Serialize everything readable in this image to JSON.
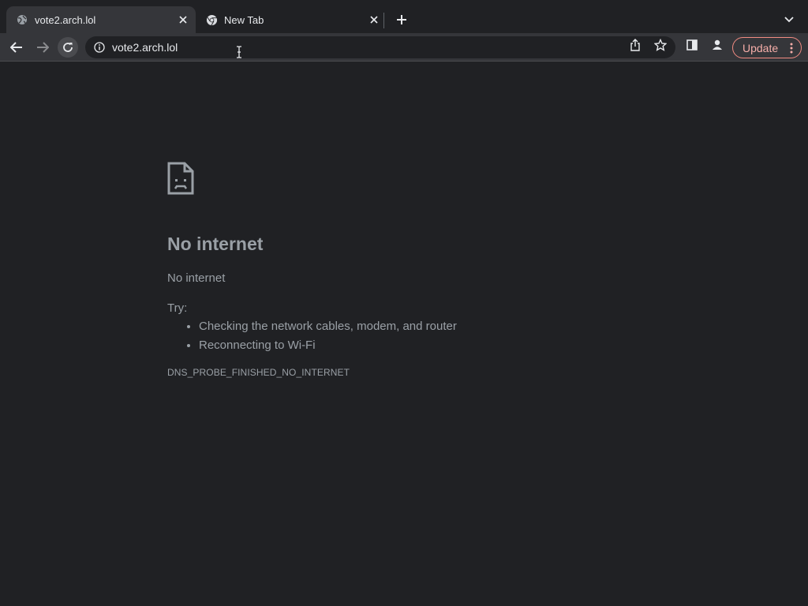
{
  "tabs": [
    {
      "title": "vote2.arch.lol",
      "icon": "globe-icon",
      "active": true
    },
    {
      "title": "New Tab",
      "icon": "chrome-icon",
      "active": false
    }
  ],
  "toolbar": {
    "url": "vote2.arch.lol",
    "update_label": "Update"
  },
  "error_page": {
    "title": "No internet",
    "subtitle": "No internet",
    "try_label": "Try:",
    "suggestions": [
      "Checking the network cables, modem, and router",
      "Reconnecting to Wi-Fi"
    ],
    "error_code": "DNS_PROBE_FINISHED_NO_INTERNET"
  },
  "colors": {
    "background": "#202124",
    "toolbar": "#35363a",
    "update_accent": "#f28b82",
    "text_muted": "#9aa0a6"
  }
}
